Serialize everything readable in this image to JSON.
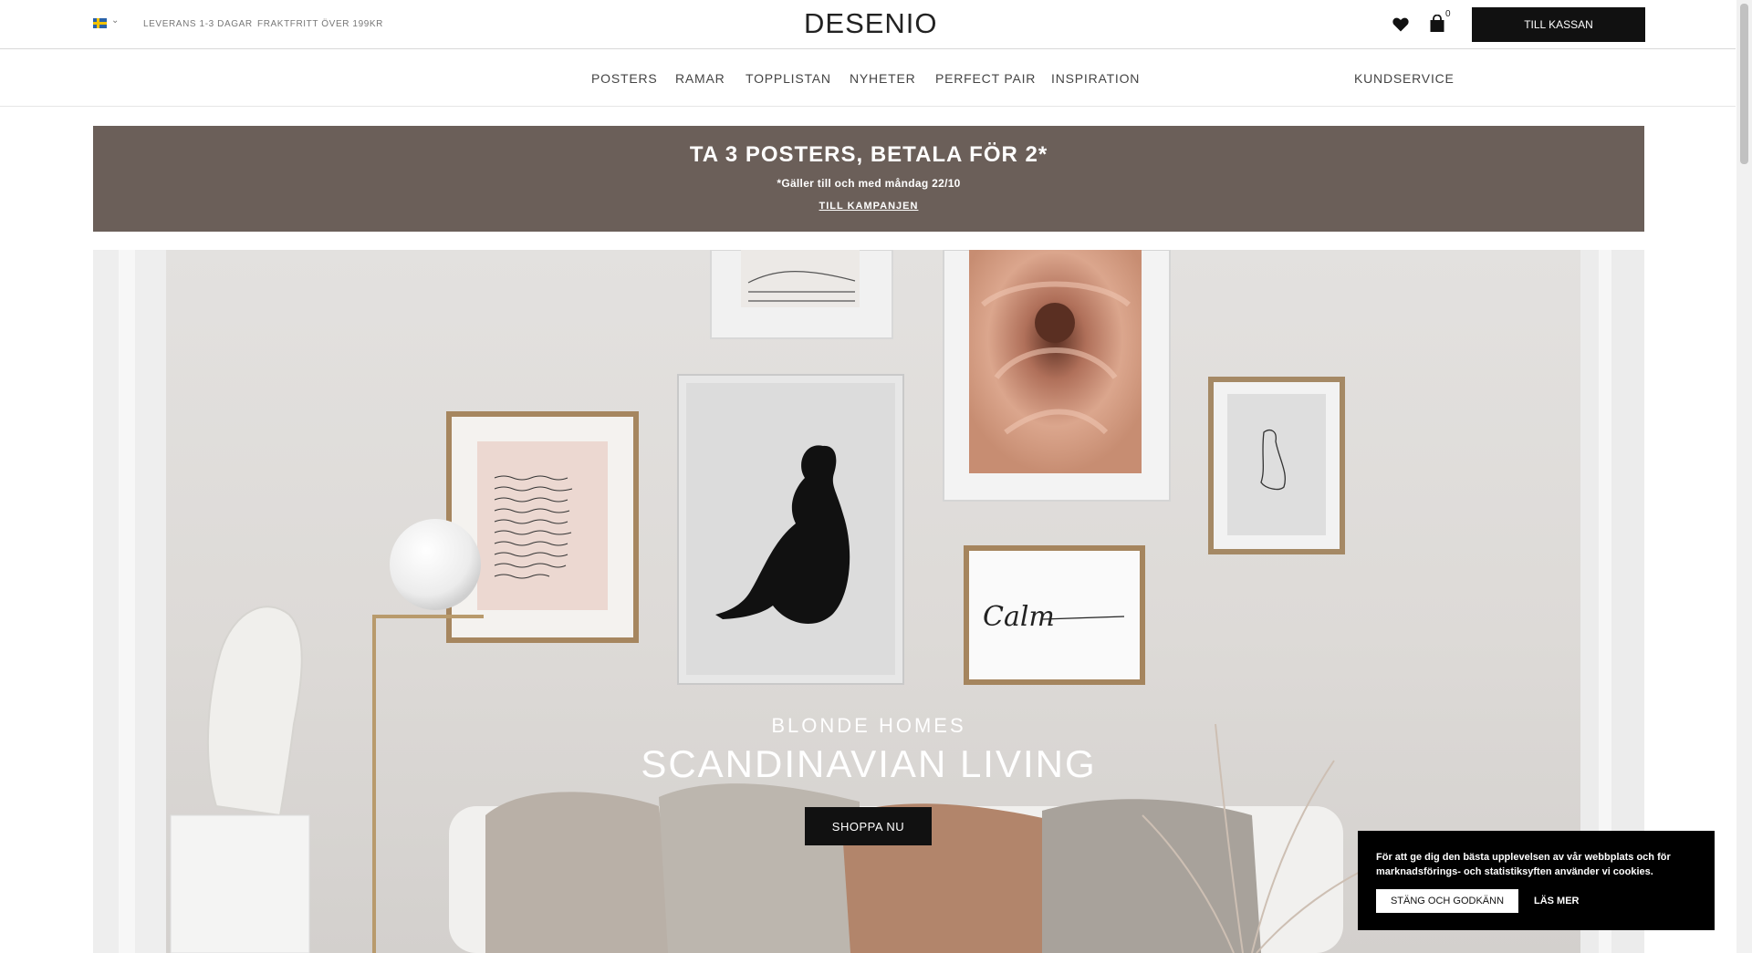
{
  "topbar": {
    "flag_icon": "sweden-flag-icon",
    "usp_delivery": "LEVERANS 1-3 DAGAR",
    "usp_shipping": "FRAKTFRITT ÖVER 199KR",
    "logo": "DESENIO",
    "wishlist_icon": "heart-icon",
    "cart_icon": "shopping-bag-icon",
    "cart_count": "0",
    "checkout_label": "TILL KASSAN"
  },
  "nav": {
    "items": [
      "POSTERS",
      "RAMAR",
      "TOPPLISTAN",
      "NYHETER",
      "PERFECT PAIR",
      "INSPIRATION"
    ],
    "service": "KUNDSERVICE"
  },
  "promo": {
    "title": "TA 3 POSTERS, BETALA FÖR 2*",
    "subtitle": "*Gäller till och med måndag 22/10",
    "link": "TILL KAMPANJEN",
    "background": "#6b5f59"
  },
  "hero": {
    "eyebrow": "BLONDE HOMES",
    "title": "SCANDINAVIAN LIVING",
    "cta": "SHOPPA NU",
    "calm_text": "Calm"
  },
  "cookie": {
    "text": "För att ge dig den bästa upplevelsen av vår webbplats och för marknadsförings- och statistiksyften använder vi cookies.",
    "accept_label": "STÄNG OCH GODKÄNN",
    "more_label": "LÄS MER"
  }
}
